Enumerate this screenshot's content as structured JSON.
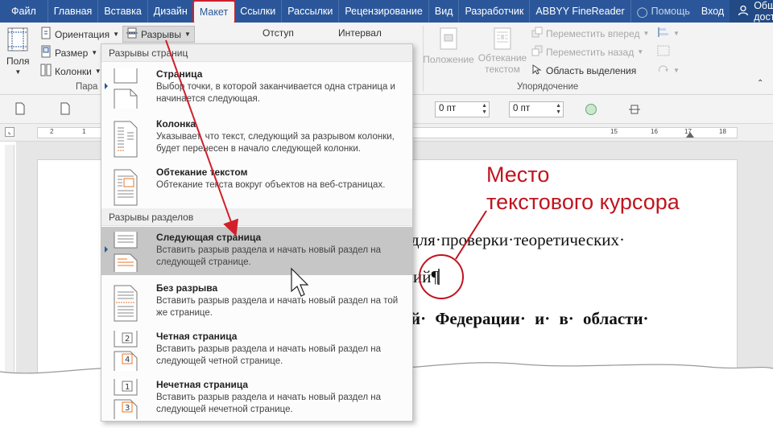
{
  "tabs": [
    {
      "label": "Файл"
    },
    {
      "label": "Главная"
    },
    {
      "label": "Вставка"
    },
    {
      "label": "Дизайн"
    },
    {
      "label": "Макет",
      "active": true
    },
    {
      "label": "Ссылки"
    },
    {
      "label": "Рассылки"
    },
    {
      "label": "Рецензирование"
    },
    {
      "label": "Вид"
    },
    {
      "label": "Разработчик"
    },
    {
      "label": "ABBYY FineReader"
    }
  ],
  "tabbar_right": {
    "help": "Помощь",
    "signin": "Вход",
    "share": "Общий доступ"
  },
  "ribbon": {
    "fields_label": "Поля",
    "orientation_label": "Ориентация",
    "size_label": "Размер",
    "columns_label": "Колонки",
    "breaks_label": "Разрывы",
    "indent_label": "Отступ",
    "spacing_label": "Интервал",
    "page_setup_group": "Пара",
    "position_label": "Положение",
    "wrap_label_1": "Обтекание",
    "wrap_label_2": "текстом",
    "bring_forward": "Переместить вперед",
    "send_backward": "Переместить назад",
    "selection_pane": "Область выделения",
    "arrange_group": "Упорядочение"
  },
  "quickbar": {
    "spacing_before": "0 пт",
    "spacing_after": "0 пт"
  },
  "ruler": {
    "ticks": [
      "2",
      "1",
      "15",
      "16",
      "17",
      "18"
    ]
  },
  "document": {
    "line1": "для·проверки·теоретических·",
    "line2": "ий¶",
    "line3": "й·  Федерации·  и·  в·  области·"
  },
  "annotation": {
    "line1": "Место",
    "line2": "текстового курсора"
  },
  "menu": {
    "page_breaks_header": "Разрывы страниц",
    "section_breaks_header": "Разрывы разделов",
    "items": [
      {
        "title": "Страница",
        "desc": "Выбор точки, в которой заканчивается одна страница и начинается следующая."
      },
      {
        "title": "Колонка",
        "desc": "Указывает, что текст, следующий за разрывом колонки, будет перенесен в начало следующей колонки."
      },
      {
        "title": "Обтекание текстом",
        "desc": "Обтекание текста вокруг объектов на веб-страницах."
      },
      {
        "title": "Следующая страница",
        "desc": "Вставить разрыв раздела и начать новый раздел на следующей странице."
      },
      {
        "title": "Без разрыва",
        "desc": "Вставить разрыв раздела и начать новый раздел на той же странице."
      },
      {
        "title": "Четная страница",
        "desc": "Вставить разрыв раздела и начать новый раздел на следующей четной странице."
      },
      {
        "title": "Нечетная страница",
        "desc": "Вставить разрыв раздела и начать новый раздел на следующей нечетной странице."
      }
    ]
  },
  "colors": {
    "ribbon_blue": "#2b579a",
    "annotation_red": "#c0141e",
    "menu_hover": "#c6c6c6"
  }
}
